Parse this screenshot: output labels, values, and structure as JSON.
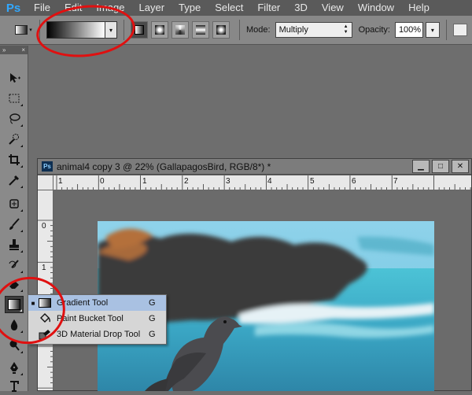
{
  "app": {
    "logo": "Ps"
  },
  "menubar": {
    "items": [
      "File",
      "Edit",
      "Image",
      "Layer",
      "Type",
      "Select",
      "Filter",
      "3D",
      "View",
      "Window",
      "Help"
    ]
  },
  "options": {
    "mode_label": "Mode:",
    "mode_value": "Multiply",
    "opacity_label": "Opacity:",
    "opacity_value": "100%",
    "dropdown_arrow": "▾"
  },
  "toolbox": {
    "collapse_glyph": "»",
    "close_glyph": "×"
  },
  "document": {
    "title": "animal4 copy 3 @ 22% (GallapagosBird, RGB/8*) *",
    "tab_icon": "Ps",
    "buttons": {
      "minimize": "▁",
      "restore": "□",
      "close": "✕"
    },
    "h_ruler": [
      "1",
      "0",
      "1",
      "2",
      "3",
      "4",
      "5",
      "6",
      "7"
    ],
    "v_ruler": [
      "0",
      "1",
      "2"
    ]
  },
  "flyout": {
    "items": [
      {
        "label": "Gradient Tool",
        "shortcut": "G",
        "icon": "gradient-icon",
        "selected": true
      },
      {
        "label": "Paint Bucket Tool",
        "shortcut": "G",
        "icon": "paint-bucket-icon",
        "selected": false
      },
      {
        "label": "3D Material Drop Tool",
        "shortcut": "G",
        "icon": "material-drop-icon",
        "selected": false
      }
    ],
    "bullet": "■"
  },
  "colors": {
    "annotation": "#e01010",
    "highlight": "#a9c1e2",
    "ps_blue": "#31a8ff"
  }
}
